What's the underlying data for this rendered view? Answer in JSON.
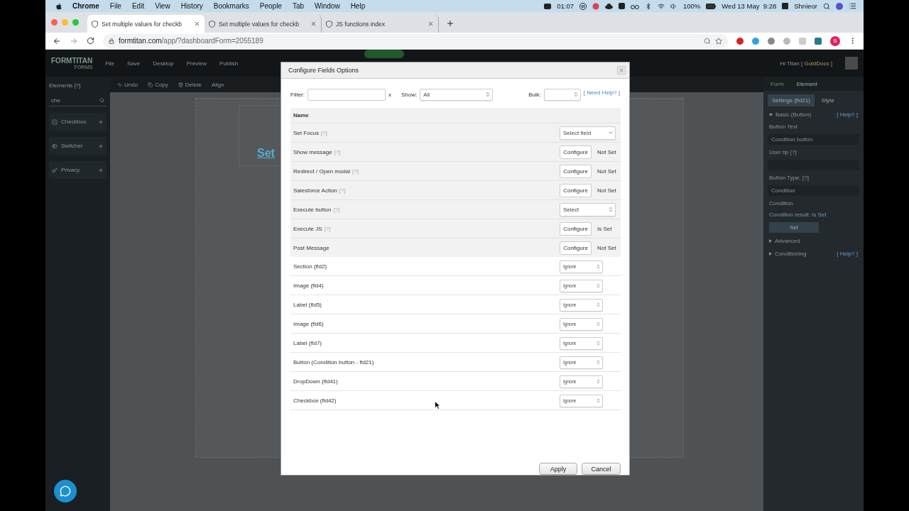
{
  "menubar": {
    "app": "Chrome",
    "menus": [
      "File",
      "Edit",
      "View",
      "History",
      "Bookmarks",
      "People",
      "Tab",
      "Window",
      "Help"
    ],
    "timer": "01:07",
    "battery": "100%",
    "datetime": "Wed 13 May  9:28",
    "user": "Shnieor"
  },
  "browser": {
    "tabs": [
      {
        "title": "Set multiple values for checkb",
        "selected": true
      },
      {
        "title": "Set multiple values for checkb",
        "selected": false
      },
      {
        "title": "JS functions index",
        "selected": false
      }
    ],
    "url_host": "formtitan.com",
    "url_path": "/app/?dashboardForm=2055189",
    "profile": "S"
  },
  "app": {
    "logo": "FORMTITAN",
    "logo_sub": "FORMS",
    "toolbar": [
      "File",
      "Save",
      "Desktop",
      "Preview",
      "Publish"
    ],
    "greeting": "Hi Titan [",
    "account": "GoldDocs",
    "greeting_end": "]",
    "sidebar": {
      "title": "Elements [?]",
      "search": "che",
      "items": [
        {
          "label": "Checkbox"
        },
        {
          "label": "Switcher"
        },
        {
          "label": "Privacy"
        }
      ]
    },
    "edit_tools": [
      "Undo",
      "Copy",
      "Delete",
      "Align"
    ],
    "canvas_text": "Set",
    "panel": {
      "tabs": [
        {
          "label": "Form",
          "selected": false
        },
        {
          "label": "Element",
          "selected": true
        }
      ],
      "subtabs": [
        {
          "label": "Settings (fld21)",
          "selected": true
        },
        {
          "label": "Style",
          "selected": false
        }
      ],
      "section": "Basic (Button)",
      "help": "[ Help? ]",
      "button_text_label": "Button Text",
      "button_text": "Condition button",
      "user_tip_label": "User tip [?]",
      "button_type_label": "Button Type: [?]",
      "button_type": "Condition",
      "condition_label": "Condition",
      "condition_result_label": "Condition result:",
      "condition_result": "Is Set",
      "set_button": "Set",
      "collapsed": [
        {
          "label": "Advanced"
        },
        {
          "label": "Conditioning",
          "help": "[ Help? ]"
        }
      ]
    }
  },
  "dialog": {
    "title": "Configure Fields Options",
    "filter_label": "Filter:",
    "clear": "x",
    "show_label": "Show:",
    "show_value": "All",
    "bulk_label": "Bulk:",
    "help_link": "[ Need Help? ]",
    "column": "Name",
    "actions": [
      {
        "name": "Set Focus",
        "help": "[?]",
        "kind": "dropdown",
        "value": "Select field"
      },
      {
        "name": "Show message",
        "help": "[?]",
        "kind": "configure",
        "button": "Configure",
        "status": "Not Set"
      },
      {
        "name": "Redirect / Open modal",
        "help": "[?]",
        "kind": "configure",
        "button": "Configure",
        "status": "Not Set"
      },
      {
        "name": "Salesforce Action",
        "help": "[?]",
        "kind": "configure",
        "button": "Configure",
        "status": "Not Set"
      },
      {
        "name": "Execute button",
        "help": "[?]",
        "kind": "select",
        "value": "Select"
      },
      {
        "name": "Execute JS",
        "help": "[?]",
        "kind": "configure",
        "button": "Configure",
        "status": "Is Set"
      },
      {
        "name": "Post Message",
        "kind": "configure",
        "button": "Configure",
        "status": "Not Set"
      }
    ],
    "fields": [
      {
        "name": "Section (fld2)",
        "option": "Ignore"
      },
      {
        "name": "Image (fld4)",
        "option": "Ignore"
      },
      {
        "name": "Label (fld5)",
        "option": "Ignore"
      },
      {
        "name": "Image (fld6)",
        "option": "Ignore"
      },
      {
        "name": "Label (fld7)",
        "option": "Ignore"
      },
      {
        "name": "Button (Condition button - fld21)",
        "option": "Ignore"
      },
      {
        "name": "DropDown (fld41)",
        "option": "Ignore"
      },
      {
        "name": "Checkbox (fld42)",
        "option": "Ignore"
      }
    ],
    "apply": "Apply",
    "cancel": "Cancel"
  }
}
